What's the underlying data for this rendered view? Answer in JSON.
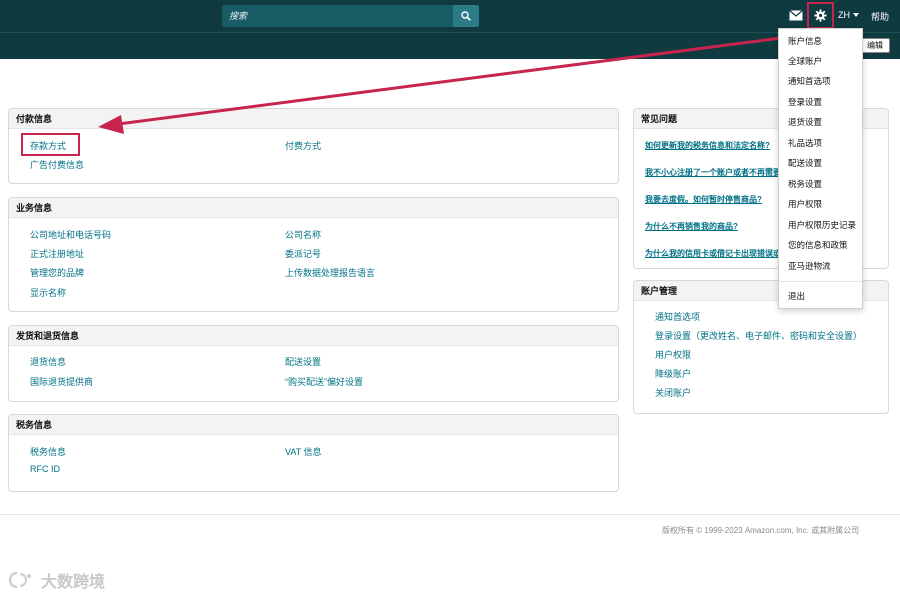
{
  "header": {
    "search_placeholder": "搜索",
    "lang_label": "ZH",
    "help_label": "帮助",
    "edit_label": "编辑"
  },
  "dropdown": {
    "items": [
      "账户信息",
      "全球账户",
      "通知首选项",
      "登录设置",
      "退货设置",
      "礼品选项",
      "配送设置",
      "税务设置",
      "用户权限",
      "用户权限历史记录",
      "您的信息和政策",
      "亚马逊物流"
    ],
    "logout": "退出"
  },
  "cards": {
    "payment": {
      "title": "付款信息",
      "links": [
        "存款方式",
        "付费方式",
        "广告付费信息"
      ]
    },
    "business": {
      "title": "业务信息",
      "links": [
        "公司地址和电话号码",
        "公司名称",
        "正式注册地址",
        "委派记号",
        "管理您的品牌",
        "上传数据处理报告语言",
        "显示名称"
      ]
    },
    "shipping": {
      "title": "发货和退货信息",
      "links": [
        "退货信息",
        "配送设置",
        "国际退货提供商",
        "“购买配送”偏好设置"
      ]
    },
    "tax": {
      "title": "税务信息",
      "links": [
        "税务信息",
        "VAT 信息",
        "RFC ID"
      ]
    },
    "faq": {
      "title": "常见问题",
      "links": [
        "如何更新我的税务信息和法定名称?",
        "我不小心注册了一个账户或者不再需要我的销售账户?",
        "我要去度假。如何暂时停售商品?",
        "为什么不再销售我的商品?",
        "为什么我的信用卡或借记卡出现错误或被拒?"
      ]
    },
    "account": {
      "title": "账户管理",
      "links": [
        "通知首选项",
        "登录设置（更改姓名、电子邮件、密码和安全设置）",
        "用户权限",
        "降级账户",
        "关闭账户"
      ]
    }
  },
  "footer": {
    "copyright": "版权所有 © 1999-2023 Amazon.com, Inc. 或其附属公司"
  },
  "watermark": "大数跨境",
  "colors": {
    "header_bg": "#0e3a40",
    "link": "#007185",
    "highlight": "#c7254e"
  }
}
